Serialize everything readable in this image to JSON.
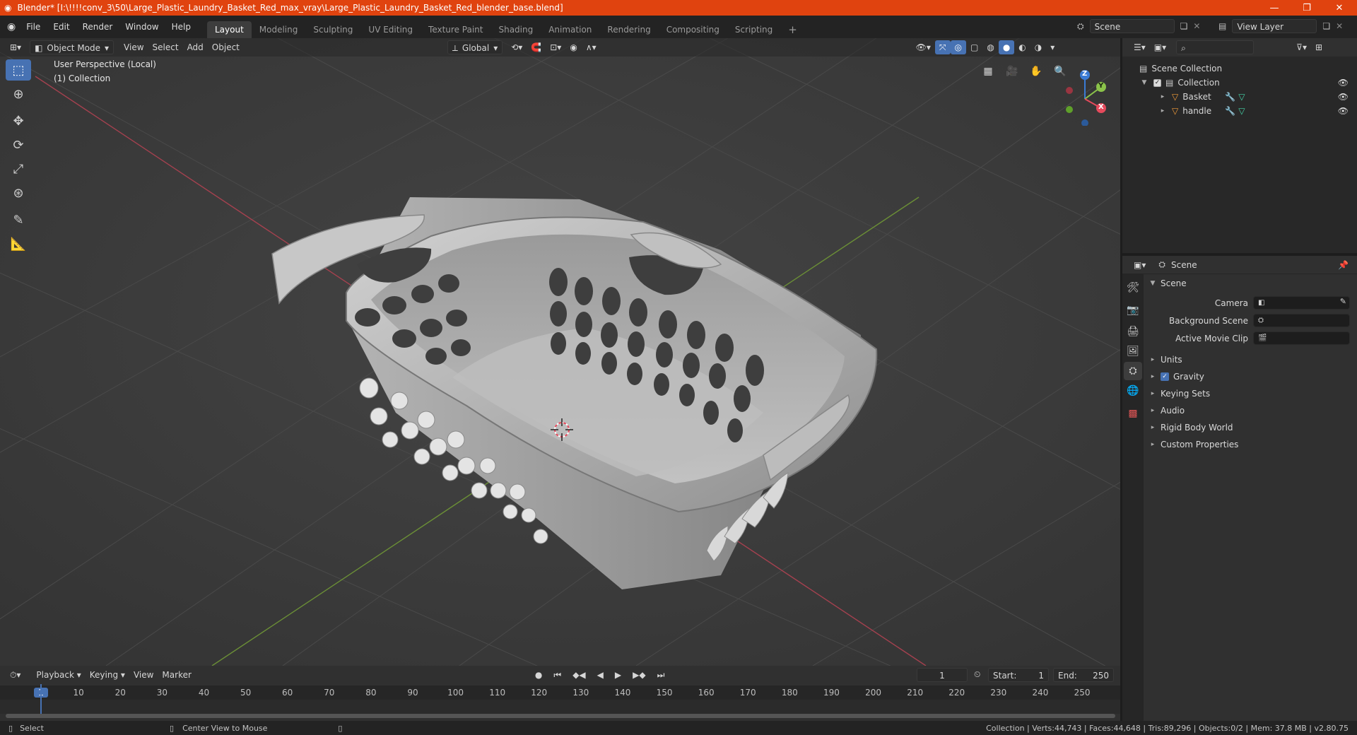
{
  "window": {
    "title": "Blender* [I:\\!!!!conv_3\\50\\Large_Plastic_Laundry_Basket_Red_max_vray\\Large_Plastic_Laundry_Basket_Red_blender_base.blend]",
    "minimize": "—",
    "maximize": "❐",
    "close": "✕"
  },
  "menus": [
    "File",
    "Edit",
    "Render",
    "Window",
    "Help"
  ],
  "workspaces": [
    "Layout",
    "Modeling",
    "Sculpting",
    "UV Editing",
    "Texture Paint",
    "Shading",
    "Animation",
    "Rendering",
    "Compositing",
    "Scripting"
  ],
  "workspace_add": "+",
  "scene_selector": "Scene",
  "view_layer_selector": "View Layer",
  "viewport": {
    "mode": "Object Mode",
    "menus": [
      "View",
      "Select",
      "Add",
      "Object"
    ],
    "transform_orientation": "Global",
    "perspective_label": "User Perspective (Local)",
    "collection_label": "(1) Collection",
    "gizmo": {
      "x": "X",
      "y": "Y",
      "z": "Z"
    }
  },
  "colors": {
    "accent": "#4772b3",
    "titlebar": "#e0430f",
    "x_axis": "#e64a5c",
    "y_axis": "#8bc34a",
    "z_axis": "#3a7bd5"
  },
  "outliner": {
    "root": "Scene Collection",
    "collection": "Collection",
    "objects": [
      "Basket",
      "handle"
    ]
  },
  "properties": {
    "context": "Scene",
    "panel": "Scene",
    "fields": [
      {
        "label": "Camera"
      },
      {
        "label": "Background Scene"
      },
      {
        "label": "Active Movie Clip"
      }
    ],
    "sections": [
      {
        "label": "Units",
        "checkbox": false
      },
      {
        "label": "Gravity",
        "checkbox": true
      },
      {
        "label": "Keying Sets",
        "checkbox": false
      },
      {
        "label": "Audio",
        "checkbox": false
      },
      {
        "label": "Rigid Body World",
        "checkbox": false
      },
      {
        "label": "Custom Properties",
        "checkbox": false
      }
    ]
  },
  "timeline": {
    "menus": [
      "Playback",
      "Keying",
      "View",
      "Marker"
    ],
    "current_frame": "1",
    "start_label": "Start:",
    "start": "1",
    "end_label": "End:",
    "end": "250",
    "ruler": [
      {
        "label": "1",
        "frame": 1
      },
      {
        "label": "10",
        "frame": 10
      },
      {
        "label": "20",
        "frame": 20
      },
      {
        "label": "30",
        "frame": 30
      },
      {
        "label": "40",
        "frame": 40
      },
      {
        "label": "50",
        "frame": 50
      },
      {
        "label": "60",
        "frame": 60
      },
      {
        "label": "70",
        "frame": 70
      },
      {
        "label": "80",
        "frame": 80
      },
      {
        "label": "90",
        "frame": 90
      },
      {
        "label": "100",
        "frame": 100
      },
      {
        "label": "110",
        "frame": 110
      },
      {
        "label": "120",
        "frame": 120
      },
      {
        "label": "130",
        "frame": 130
      },
      {
        "label": "140",
        "frame": 140
      },
      {
        "label": "150",
        "frame": 150
      },
      {
        "label": "160",
        "frame": 160
      },
      {
        "label": "170",
        "frame": 170
      },
      {
        "label": "180",
        "frame": 180
      },
      {
        "label": "190",
        "frame": 190
      },
      {
        "label": "200",
        "frame": 200
      },
      {
        "label": "210",
        "frame": 210
      },
      {
        "label": "220",
        "frame": 220
      },
      {
        "label": "230",
        "frame": 230
      },
      {
        "label": "240",
        "frame": 240
      },
      {
        "label": "250",
        "frame": 250
      }
    ]
  },
  "statusbar": {
    "left_action": "Select",
    "middle_action": "Center View to Mouse",
    "stats": "Collection | Verts:44,743 | Faces:44,648 | Tris:89,296 | Objects:0/2 | Mem: 37.8 MB | v2.80.75"
  }
}
